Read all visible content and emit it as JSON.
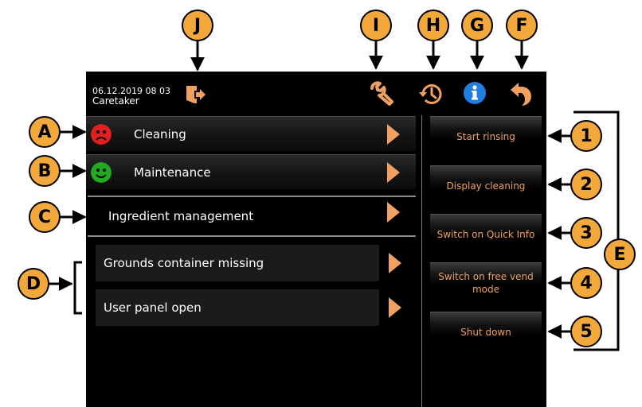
{
  "header": {
    "datetime": "06.12.2019 08 03",
    "user": "Caretaker",
    "icons": [
      "logout-icon",
      "wrench-icon",
      "history-icon",
      "info-icon",
      "back-icon"
    ]
  },
  "main_menu": [
    {
      "label": "Cleaning",
      "status_icon": "sad-face-icon",
      "status_color": "#e02020"
    },
    {
      "label": "Maintenance",
      "status_icon": "happy-face-icon",
      "status_color": "#22aa22"
    },
    {
      "label": "Ingredient management"
    }
  ],
  "messages": [
    {
      "label": "Grounds container missing"
    },
    {
      "label": "User panel open"
    }
  ],
  "side_buttons": [
    {
      "label": "Start rinsing"
    },
    {
      "label": "Display cleaning"
    },
    {
      "label": "Switch on Quick Info"
    },
    {
      "label": "Switch on free vend mode"
    },
    {
      "label": "Shut down"
    }
  ],
  "callouts": {
    "letters": [
      "A",
      "B",
      "C",
      "D",
      "E",
      "F",
      "G",
      "H",
      "I",
      "J"
    ],
    "numbers": [
      "1",
      "2",
      "3",
      "4",
      "5"
    ]
  },
  "colors": {
    "callout": "#f2a83a",
    "accent_arrow": "#f0a060",
    "info_blue": "#1e7fe0",
    "screen_bg": "#000000"
  }
}
